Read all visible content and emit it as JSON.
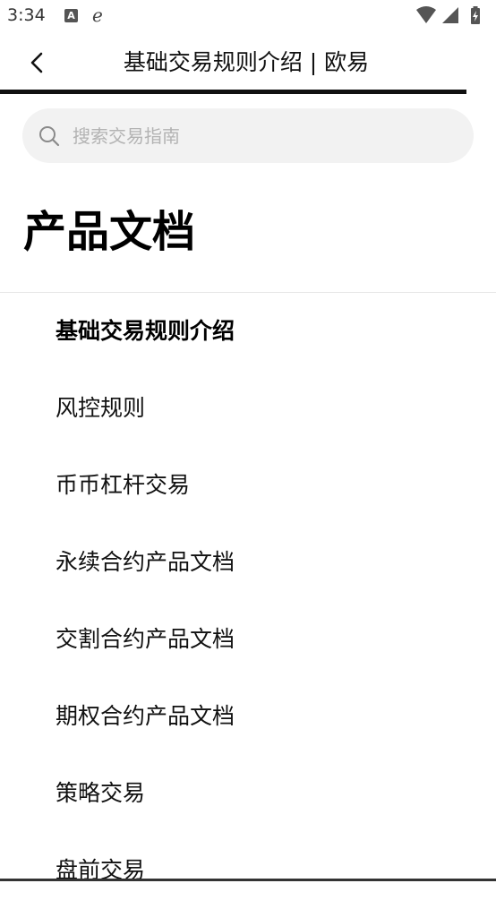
{
  "status_bar": {
    "time": "3:34",
    "icons": [
      "notification-a-icon",
      "edge-browser-icon",
      "wifi-icon",
      "signal-icon",
      "battery-charging-icon"
    ]
  },
  "header": {
    "back_icon": "back-chevron-icon",
    "title": "基础交易规则介绍 | 欧易",
    "progress_percent": 94
  },
  "search": {
    "icon": "search-icon",
    "placeholder": "搜索交易指南",
    "value": ""
  },
  "section": {
    "title": "产品文档"
  },
  "doc_list": {
    "active_index": 0,
    "items": [
      {
        "label": "基础交易规则介绍"
      },
      {
        "label": "风控规则"
      },
      {
        "label": "币币杠杆交易"
      },
      {
        "label": "永续合约产品文档"
      },
      {
        "label": "交割合约产品文档"
      },
      {
        "label": "期权合约产品文档"
      },
      {
        "label": "策略交易"
      },
      {
        "label": "盘前交易"
      }
    ]
  },
  "colors": {
    "text": "#111111",
    "placeholder": "#b3b3b3",
    "search_bg": "#f2f2f2",
    "divider": "#e6e6e6"
  }
}
